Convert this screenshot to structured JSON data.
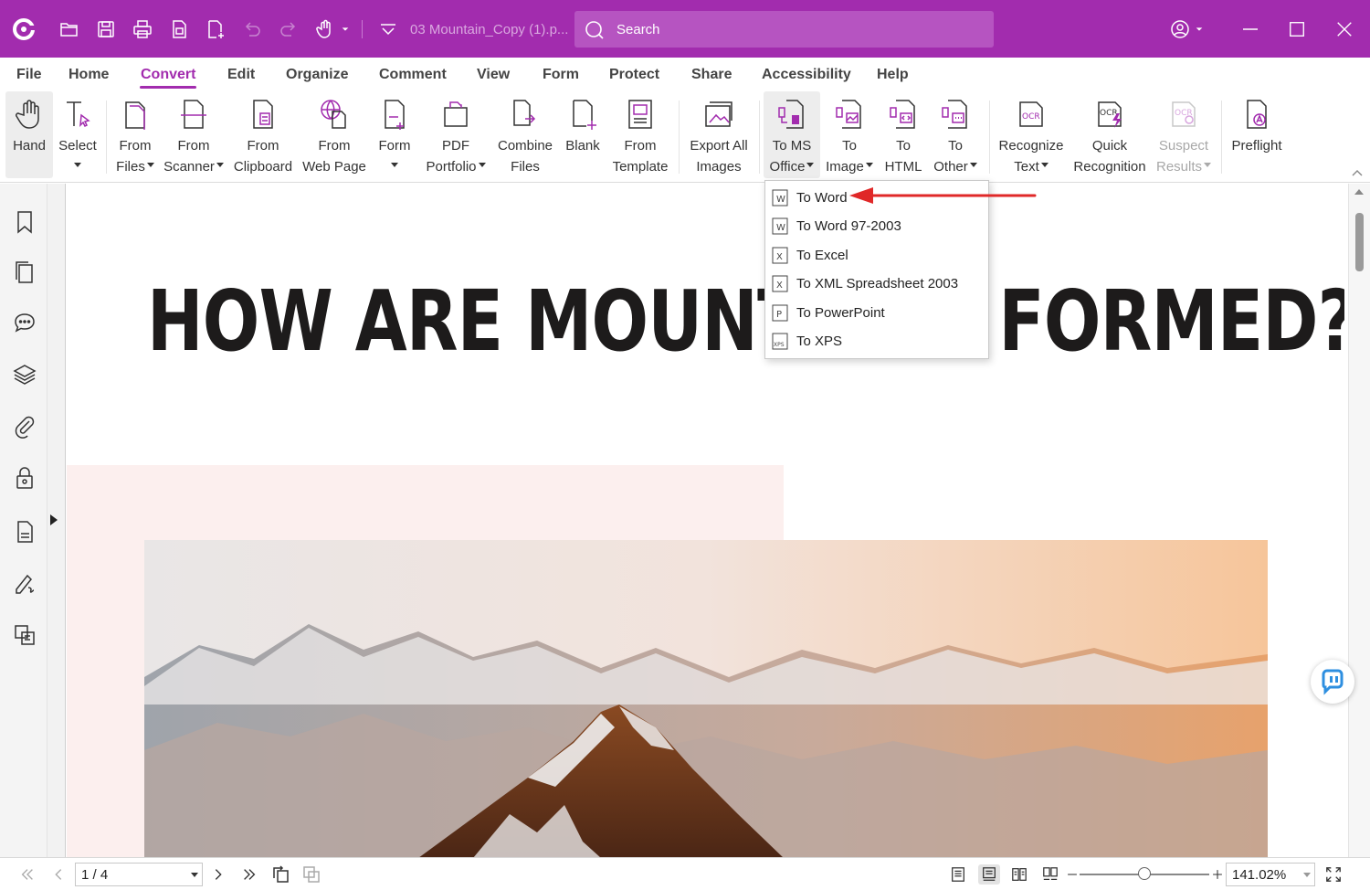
{
  "app": {
    "document_title": "03 Mountain_Copy (1).p...",
    "search_placeholder": "Search",
    "accent_color": "#a22cae"
  },
  "menu": {
    "tabs": [
      "File",
      "Home",
      "Convert",
      "Edit",
      "Organize",
      "Comment",
      "View",
      "Form",
      "Protect",
      "Share",
      "Accessibility",
      "Help"
    ],
    "active": "Convert"
  },
  "ribbon": {
    "hand": {
      "l1": "Hand"
    },
    "select": {
      "l1": "Select"
    },
    "from_files": {
      "l1": "From",
      "l2": "Files"
    },
    "from_scanner": {
      "l1": "From",
      "l2": "Scanner"
    },
    "from_clipboard": {
      "l1": "From",
      "l2": "Clipboard"
    },
    "from_web_page": {
      "l1": "From",
      "l2": "Web Page"
    },
    "form": {
      "l1": "Form"
    },
    "pdf_portfolio": {
      "l1": "PDF",
      "l2": "Portfolio"
    },
    "combine_files": {
      "l1": "Combine",
      "l2": "Files"
    },
    "blank": {
      "l1": "Blank"
    },
    "from_template": {
      "l1": "From",
      "l2": "Template"
    },
    "export_all_images": {
      "l1": "Export All",
      "l2": "Images"
    },
    "to_ms_office": {
      "l1": "To MS",
      "l2": "Office"
    },
    "to_image": {
      "l1": "To",
      "l2": "Image"
    },
    "to_html": {
      "l1": "To",
      "l2": "HTML"
    },
    "to_other": {
      "l1": "To",
      "l2": "Other"
    },
    "recognize_text": {
      "l1": "Recognize",
      "l2": "Text"
    },
    "quick_recognition": {
      "l1": "Quick",
      "l2": "Recognition"
    },
    "suspect_results": {
      "l1": "Suspect",
      "l2": "Results"
    },
    "preflight": {
      "l1": "Preflight"
    },
    "ocr_icon_text": "OCR"
  },
  "dropdown": {
    "items": [
      "To Word",
      "To Word 97-2003",
      "To Excel",
      "To XML Spreadsheet 2003",
      "To PowerPoint",
      "To XPS"
    ],
    "icon_letters": [
      "W",
      "W",
      "X",
      "X",
      "P",
      "XPS"
    ]
  },
  "document": {
    "heading": "HOW ARE MOUNTAINS FORMED?"
  },
  "status": {
    "page_value": "1 / 4",
    "zoom_value": "141.02%",
    "zoom_fraction": 0.5
  }
}
